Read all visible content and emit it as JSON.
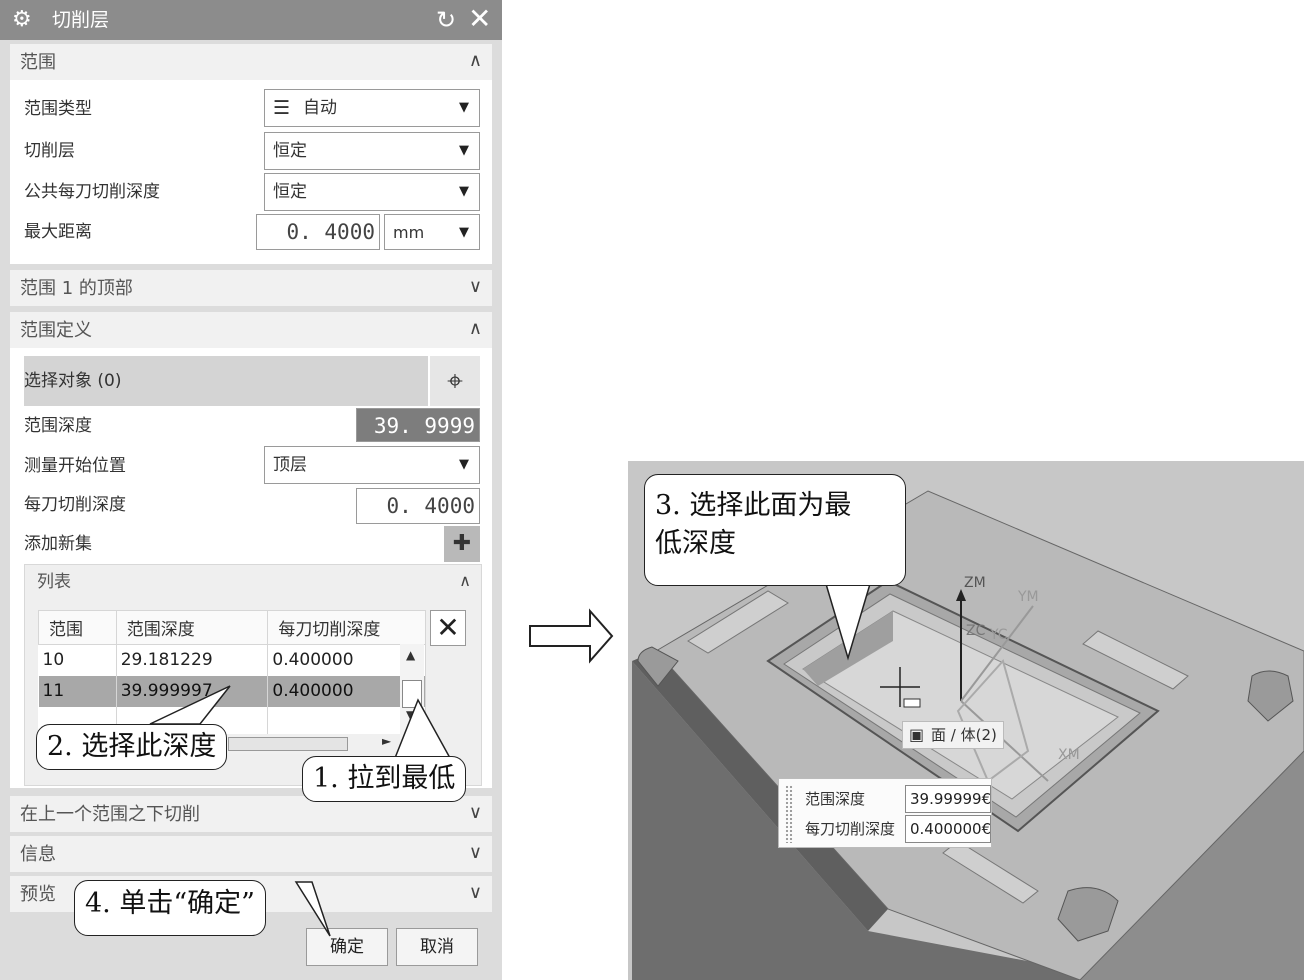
{
  "dialog": {
    "title": "切削层",
    "icons": {
      "title": "gear-icon",
      "reset": "reset-icon",
      "close": "close-icon"
    },
    "range_section": {
      "header": "范围",
      "range_type": {
        "label": "范围类型",
        "value": "自动"
      },
      "cut_levels": {
        "label": "切削层",
        "value": "恒定"
      },
      "common_depth": {
        "label": "公共每刀切削深度",
        "value": "恒定"
      },
      "max_distance": {
        "label": "最大距离",
        "value": "0. 4000",
        "unit": "mm"
      }
    },
    "range_top_section": {
      "header": "范围 1 的顶部"
    },
    "range_def_section": {
      "header": "范围定义",
      "select_object": "选择对象 (0)",
      "range_depth": {
        "label": "范围深度",
        "value": "39. 9999"
      },
      "measure_from": {
        "label": "测量开始位置",
        "value": "顶层"
      },
      "depth_per_cut": {
        "label": "每刀切削深度",
        "value": "0. 4000"
      },
      "add_new_set": "添加新集",
      "list": {
        "header": "列表",
        "columns": [
          "范围",
          "范围深度",
          "每刀切削深度"
        ],
        "rows": [
          {
            "range": "10",
            "depth": "29.181229",
            "per_cut": "0.400000"
          },
          {
            "range": "11",
            "depth": "39.999997",
            "per_cut": "0.400000"
          }
        ]
      }
    },
    "below_section": {
      "header": "在上一个范围之下切削"
    },
    "info_section": {
      "header": "信息"
    },
    "preview_section": {
      "header": "预览"
    },
    "ok": "确定",
    "cancel": "取消"
  },
  "callouts": {
    "step1": "1. 拉到最低",
    "step2": "2. 选择此深度",
    "step3_line1": "3. 选择此面为最",
    "step3_line2": "低深度",
    "step4": "4. 单击“确定”"
  },
  "viewport": {
    "axes": {
      "zm": "ZM",
      "ym": "YM",
      "zc": "ZC",
      "yc": "YC",
      "xm": "XM"
    },
    "tooltip": "面 / 体(2)",
    "fields": {
      "range_depth": {
        "label": "范围深度",
        "value": "39.99999€"
      },
      "depth_per_cut": {
        "label": "每刀切削深度",
        "value": "0.400000€"
      }
    }
  },
  "colors": {
    "title_bar": "#8c8c8c",
    "selected_row": "#a8a8a8",
    "viewport_bg": "#c7c7c7",
    "part_top": "#b9b9b9"
  }
}
